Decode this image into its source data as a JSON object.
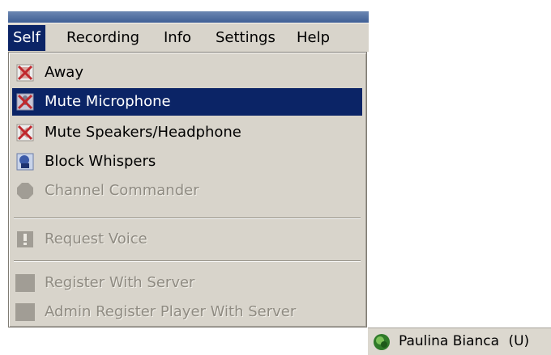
{
  "menubar": {
    "items": [
      {
        "label": "Self",
        "active": true
      },
      {
        "label": "Recording"
      },
      {
        "label": "Info"
      },
      {
        "label": "Settings"
      },
      {
        "label": "Help"
      }
    ]
  },
  "self_menu": {
    "items": [
      {
        "label": "Away",
        "icon": "away-icon",
        "enabled": true
      },
      {
        "label": "Mute Microphone",
        "icon": "mute-microphone-icon",
        "enabled": true,
        "highlighted": true
      },
      {
        "label": "Mute Speakers/Headphone",
        "icon": "mute-speakers-icon",
        "enabled": true
      },
      {
        "label": "Block Whispers",
        "icon": "block-whispers-icon",
        "enabled": true
      },
      {
        "label": "Channel Commander",
        "icon": "channel-commander-icon",
        "enabled": false
      },
      {
        "label": "Request Voice",
        "icon": "request-voice-icon",
        "enabled": false
      },
      {
        "label": "Register With Server",
        "icon": "register-icon",
        "enabled": false
      },
      {
        "label": "Admin Register Player With Server",
        "icon": "admin-register-icon",
        "enabled": false
      }
    ]
  },
  "status": {
    "player_name": "Paulina Bianca",
    "flag": "(U)",
    "player_icon": "player-status-icon"
  },
  "colors": {
    "menu_bg": "#d8d4cb",
    "highlight": "#0b2466",
    "disabled_text": "#8f8b82",
    "icon_red": "#c0282d"
  }
}
